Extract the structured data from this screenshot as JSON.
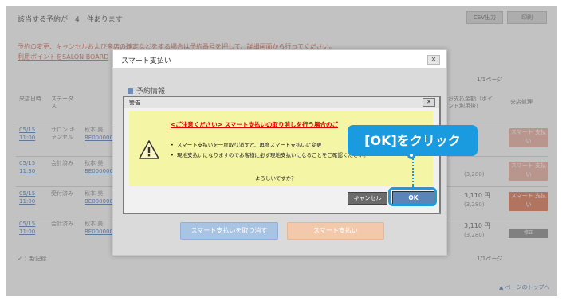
{
  "background": {
    "result_count_text": "該当する予約が　4　件あります",
    "csv_button": "CSV出力",
    "print_button": "印刷",
    "note_line1": "予約の変更、キャンセルおよび来店の確定などをする場合は予約番号を押して、詳細画面から行ってください。",
    "note_line2": "利用ポイントをSALON BOARD",
    "pager_top": "1/1ページ",
    "pager_bottom": "1/1ページ",
    "col_date": "来店日時",
    "col_status": "ステータス",
    "col_price": "お支払金額（ポイント利用後）",
    "col_action": "来店処理",
    "footer_note": "✓ ：新記録",
    "page_top": "▲ ページのトップへ",
    "rows": [
      {
        "date": "05/15",
        "time": "11:00",
        "status": "サロン キャンセル",
        "name": "秋本 美",
        "id": "BE000000",
        "price": "",
        "sub": "",
        "action": "スマート 支払い"
      },
      {
        "date": "05/15",
        "time": "11:30",
        "status": "会計済み",
        "name": "秋本 美",
        "id": "BE000000",
        "price": "",
        "sub": "(3,280)",
        "action": "スマート 支払い"
      },
      {
        "date": "05/15",
        "time": "11:00",
        "status": "受付済み",
        "name": "秋本 美",
        "id": "BE000000",
        "price": "3,110 円",
        "sub": "(3,280)",
        "action": "スマート 支払い"
      },
      {
        "date": "05/15",
        "time": "11:00",
        "status": "会計済み",
        "name": "秋本 美",
        "id": "BE000000",
        "price": "3,110 円",
        "sub": "(3,280)",
        "action": "修正"
      }
    ]
  },
  "modal": {
    "title": "スマート支払い",
    "close": "✕",
    "section_title": "予約情報",
    "cancel_smart_pay_button": "スマート支払いを取り消す",
    "smart_pay_button": "スマート支払い"
  },
  "alert": {
    "title": "警告",
    "close": "✕",
    "heading": "<ご注意ください> スマート支払いの取り消しを行う場合のご",
    "bullet1": "スマート支払いを一度取り消すと、再度スマート支払いに変更",
    "bullet2": "現地支払いになりますのでお客様に必ず現地支払いになることをご確認ください。",
    "question": "よろしいですか？",
    "cancel_button": "キャンセル",
    "ok_button": "OK"
  },
  "callout": {
    "text": "[OK]をクリック",
    "color": "#1a9be0"
  }
}
